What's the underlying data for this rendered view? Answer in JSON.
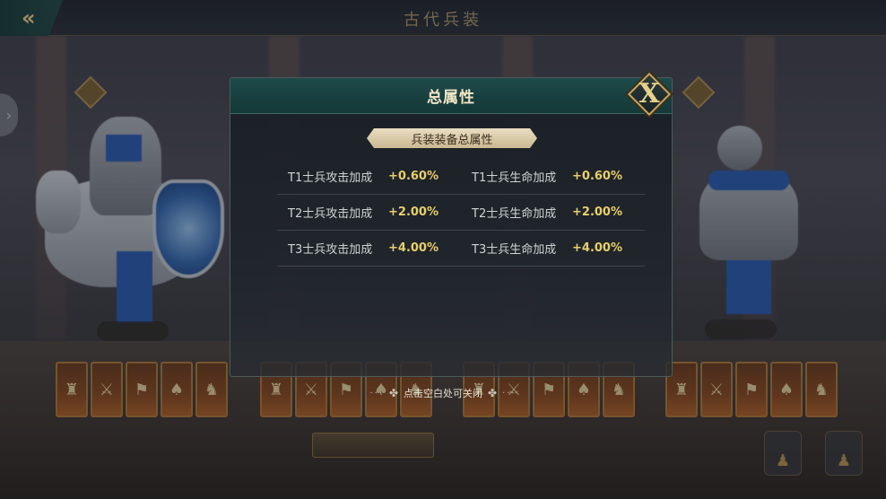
{
  "top_bar": {
    "back_icon": "double-chevron-left-icon",
    "title": "古代兵装"
  },
  "modal": {
    "title": "总属性",
    "close_label": "X",
    "section_label": "兵装装备总属性",
    "rows": [
      {
        "left_label": "T1士兵攻击加成",
        "left_value": "+0.60%",
        "right_label": "T1士兵生命加成",
        "right_value": "+0.60%"
      },
      {
        "left_label": "T2士兵攻击加成",
        "left_value": "+2.00%",
        "right_label": "T2士兵生命加成",
        "right_value": "+2.00%"
      },
      {
        "left_label": "T3士兵攻击加成",
        "left_value": "+4.00%",
        "right_label": "T3士兵生命加成",
        "right_value": "+4.00%"
      }
    ]
  },
  "hint": {
    "text": "点击空白处可关闭"
  },
  "colors": {
    "header_teal": "#1e4a4a",
    "value_gold": "#e8cf6a",
    "pill_beige": "#e9dcc0",
    "slot_orange": "#8a4a22"
  }
}
